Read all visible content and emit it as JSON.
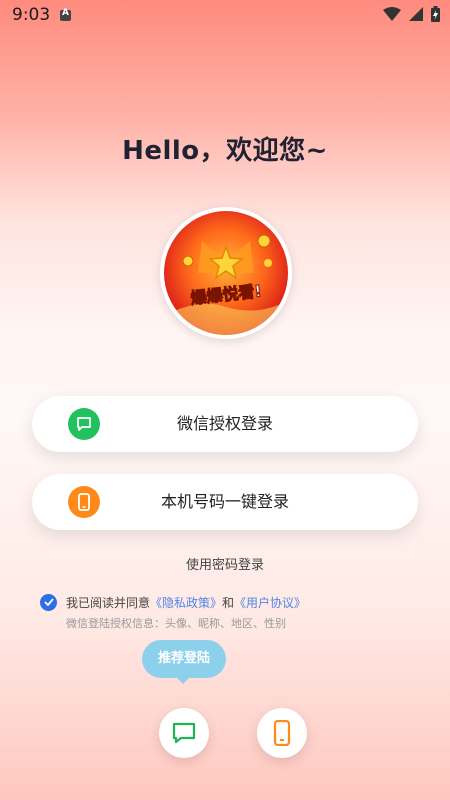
{
  "status_bar": {
    "time": "9:03"
  },
  "greeting": "Hello，欢迎您~",
  "avatar": {
    "logo_text": "爆爆悦看!"
  },
  "login_buttons": {
    "wechat": {
      "label": "微信授权登录",
      "icon": "chat-bubble-icon",
      "color": "#21c25e"
    },
    "phone": {
      "label": "本机号码一键登录",
      "icon": "phone-icon",
      "color": "#ff8a1a"
    }
  },
  "password_login": "使用密码登录",
  "agreement": {
    "prefix": "我已阅读并同意",
    "privacy": "《隐私政策》",
    "and": "和",
    "user_agreement": "《用户协议》",
    "info": "微信登陆授权信息：头像、昵称、地区、性别"
  },
  "tooltip": "推荐登陆",
  "colors": {
    "link": "#4f86e7",
    "checkbox": "#2f6fe6",
    "tooltip": "#8cd0ec"
  }
}
